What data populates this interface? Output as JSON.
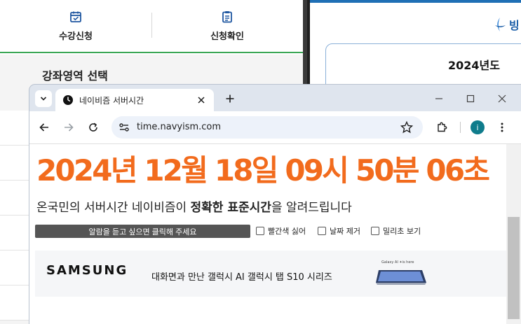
{
  "bg_left": {
    "tabs": [
      {
        "label": "수강신청",
        "icon": "calendar-check-icon"
      },
      {
        "label": "신청확인",
        "icon": "clipboard-icon"
      }
    ],
    "section_title": "강좌영역 선택"
  },
  "bg_right": {
    "logo_text": "빙",
    "card_title": "2024년도"
  },
  "browser": {
    "tab_title": "네이비즘 서버시간",
    "url": "time.navyism.com",
    "profile_initial": "i"
  },
  "page": {
    "clock_text": "2024년 12월 18일 09시 50분 06초",
    "subtitle_plain_1": "온국민의 서버시간 네이비즘이 ",
    "subtitle_bold": "정확한 표준시간",
    "subtitle_plain_2": "을 알려드립니다",
    "alarm_button": "알람을 듣고 싶으면 클릭해 주세요",
    "options": [
      "빨간색 싫어",
      "날짜 제거",
      "밀리초 보기"
    ],
    "clock_color": "#f26b1d"
  },
  "ad": {
    "brand": "SAMSUNG",
    "text": "대화면과 만난 갤럭시 AI 갤럭시 탭 S10 시리즈",
    "small_text": "Galaxy AI ✦is here"
  }
}
